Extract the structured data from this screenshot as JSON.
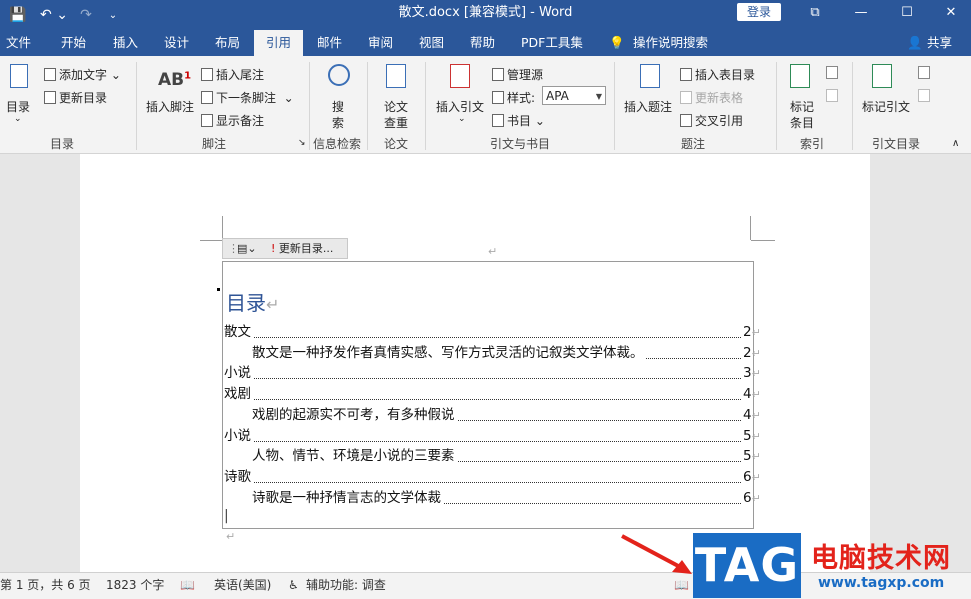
{
  "titlebar": {
    "title": "散文.docx [兼容模式] - Word",
    "login": "登录",
    "qa_save": "💾",
    "qa_undo": "↶ ⌄",
    "qa_redo": "↷",
    "qa_custom": "⌄",
    "win_restore": "⧉",
    "win_min": "—",
    "win_max": "☐",
    "win_close": "✕"
  },
  "tabs": {
    "file": "文件",
    "home": "开始",
    "insert": "插入",
    "design": "设计",
    "layout": "布局",
    "references": "引用",
    "mailings": "邮件",
    "review": "审阅",
    "view": "视图",
    "help": "帮助",
    "pdf": "PDF工具集",
    "tell": "操作说明搜索",
    "share": "共享"
  },
  "ribbon": {
    "toc_big": "目录",
    "add_text": "添加文字",
    "update_toc": "更新目录",
    "grp_toc": "目录",
    "insert_footnote": "插入脚注",
    "insert_endnote": "插入尾注",
    "next_footnote": "下一条脚注",
    "show_notes": "显示备注",
    "grp_footnotes": "脚注",
    "search": "搜",
    "search2": "索",
    "grp_research": "信息检索",
    "paper": "论文",
    "paper2": "查重",
    "grp_paper": "论文",
    "insert_citation": "插入引文",
    "manage_sources": "管理源",
    "style_label": "样式:",
    "style_value": "APA",
    "bibliography": "书目",
    "grp_citations": "引文与书目",
    "insert_caption": "插入题注",
    "insert_tof": "插入表目录",
    "update_table": "更新表格",
    "cross_ref": "交叉引用",
    "grp_captions": "题注",
    "mark_entry": "标记",
    "mark_entry2": "条目",
    "grp_index": "索引",
    "mark_citation": "标记引文",
    "grp_toa": "引文目录"
  },
  "document": {
    "cc_update": "更新目录...",
    "toc_heading": "目录",
    "para_mark": "↵",
    "toc_entries": [
      {
        "text": "散文",
        "page": "2",
        "level": 1
      },
      {
        "text": "散文是一种抒发作者真情实感、写作方式灵活的记叙类文学体裁。",
        "page": "2",
        "level": 2
      },
      {
        "text": "小说",
        "page": "3",
        "level": 1
      },
      {
        "text": "戏剧",
        "page": "4",
        "level": 1
      },
      {
        "text": "戏剧的起源实不可考，有多种假说",
        "page": "4",
        "level": 2
      },
      {
        "text": "小说",
        "page": "5",
        "level": 1
      },
      {
        "text": "人物、情节、环境是小说的三要素",
        "page": "5",
        "level": 2
      },
      {
        "text": "诗歌",
        "page": "6",
        "level": 1
      },
      {
        "text": "诗歌是一种抒情言志的文学体裁",
        "page": "6",
        "level": 2
      }
    ]
  },
  "status": {
    "page": "第 1 页，共 6 页",
    "words": "1823 个字",
    "language": "英语(美国)",
    "accessibility": "辅助功能: 调查"
  },
  "watermark": {
    "tag": "TAG",
    "site_cn": "电脑技术网",
    "url": "www.tagxp.com"
  },
  "colors": {
    "brand": "#2b579a",
    "ribbon_bg": "#f3f3f3",
    "toc_heading": "#2f5496"
  }
}
